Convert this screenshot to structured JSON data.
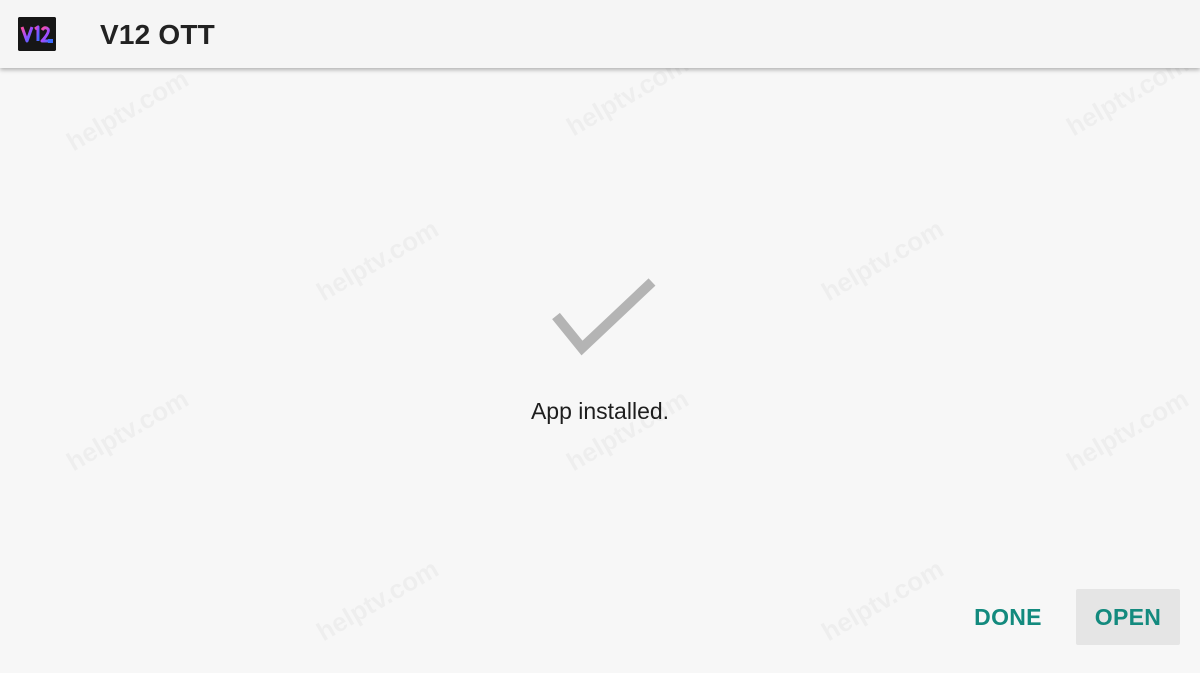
{
  "appbar": {
    "icon": "v12-app-icon",
    "title": "V12 OTT"
  },
  "status": {
    "icon": "checkmark-icon",
    "message": "App installed."
  },
  "actions": {
    "done_label": "DONE",
    "open_label": "OPEN"
  },
  "colors": {
    "accent": "#138a7e",
    "checkmark": "#b4b4b4",
    "background": "#f7f7f7"
  }
}
